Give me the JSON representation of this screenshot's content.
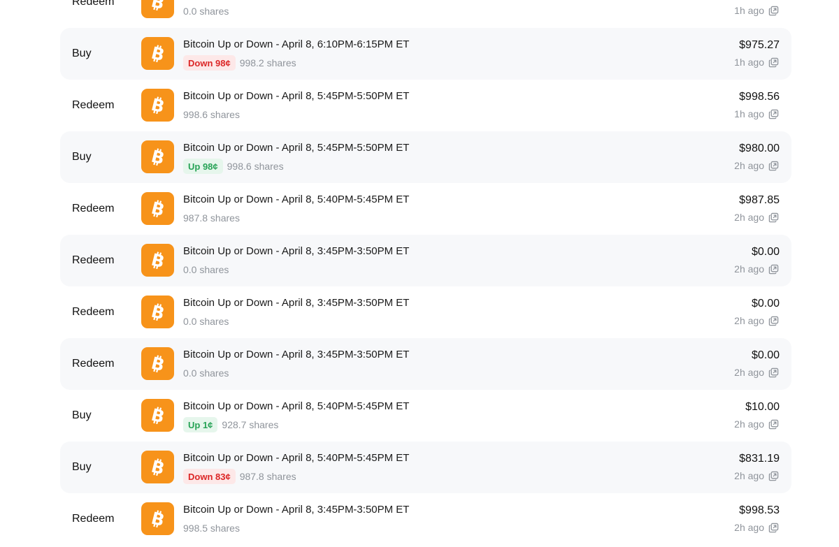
{
  "activity": {
    "rows": [
      {
        "action": "Redeem",
        "title": "",
        "outcome": "",
        "outcome_kind": "none",
        "shares": "0.0 shares",
        "amount": "",
        "time": "1h ago",
        "icon": "bitcoin-icon"
      },
      {
        "action": "Buy",
        "title": "Bitcoin Up or Down - April 8, 6:10PM-6:15PM ET",
        "outcome": "Down 98¢",
        "outcome_kind": "down",
        "shares": "998.2 shares",
        "amount": "$975.27",
        "time": "1h ago",
        "icon": "bitcoin-icon"
      },
      {
        "action": "Redeem",
        "title": "Bitcoin Up or Down - April 8, 5:45PM-5:50PM ET",
        "outcome": "",
        "outcome_kind": "none",
        "shares": "998.6 shares",
        "amount": "$998.56",
        "time": "1h ago",
        "icon": "bitcoin-icon"
      },
      {
        "action": "Buy",
        "title": "Bitcoin Up or Down - April 8, 5:45PM-5:50PM ET",
        "outcome": "Up 98¢",
        "outcome_kind": "up",
        "shares": "998.6 shares",
        "amount": "$980.00",
        "time": "2h ago",
        "icon": "bitcoin-icon"
      },
      {
        "action": "Redeem",
        "title": "Bitcoin Up or Down - April 8, 5:40PM-5:45PM ET",
        "outcome": "",
        "outcome_kind": "none",
        "shares": "987.8 shares",
        "amount": "$987.85",
        "time": "2h ago",
        "icon": "bitcoin-icon"
      },
      {
        "action": "Redeem",
        "title": "Bitcoin Up or Down - April 8, 3:45PM-3:50PM ET",
        "outcome": "",
        "outcome_kind": "none",
        "shares": "0.0 shares",
        "amount": "$0.00",
        "time": "2h ago",
        "icon": "bitcoin-icon"
      },
      {
        "action": "Redeem",
        "title": "Bitcoin Up or Down - April 8, 3:45PM-3:50PM ET",
        "outcome": "",
        "outcome_kind": "none",
        "shares": "0.0 shares",
        "amount": "$0.00",
        "time": "2h ago",
        "icon": "bitcoin-icon"
      },
      {
        "action": "Redeem",
        "title": "Bitcoin Up or Down - April 8, 3:45PM-3:50PM ET",
        "outcome": "",
        "outcome_kind": "none",
        "shares": "0.0 shares",
        "amount": "$0.00",
        "time": "2h ago",
        "icon": "bitcoin-icon"
      },
      {
        "action": "Buy",
        "title": "Bitcoin Up or Down - April 8, 5:40PM-5:45PM ET",
        "outcome": "Up 1¢",
        "outcome_kind": "up",
        "shares": "928.7 shares",
        "amount": "$10.00",
        "time": "2h ago",
        "icon": "bitcoin-icon"
      },
      {
        "action": "Buy",
        "title": "Bitcoin Up or Down - April 8, 5:40PM-5:45PM ET",
        "outcome": "Down 83¢",
        "outcome_kind": "down",
        "shares": "987.8 shares",
        "amount": "$831.19",
        "time": "2h ago",
        "icon": "bitcoin-icon"
      },
      {
        "action": "Redeem",
        "title": "Bitcoin Up or Down - April 8, 3:45PM-3:50PM ET",
        "outcome": "",
        "outcome_kind": "none",
        "shares": "998.5 shares",
        "amount": "$998.53",
        "time": "2h ago",
        "icon": "bitcoin-icon"
      }
    ]
  },
  "colors": {
    "coin": "#f7931a",
    "down_text": "#dc2626",
    "down_bg": "#fde8e8",
    "up_text": "#27a356",
    "up_bg": "#e6f6ec",
    "alt_row_bg": "#f7f8fa",
    "muted_text": "#8f949b"
  },
  "icons": {
    "coin": "bitcoin-icon",
    "link": "open-link-icon"
  }
}
